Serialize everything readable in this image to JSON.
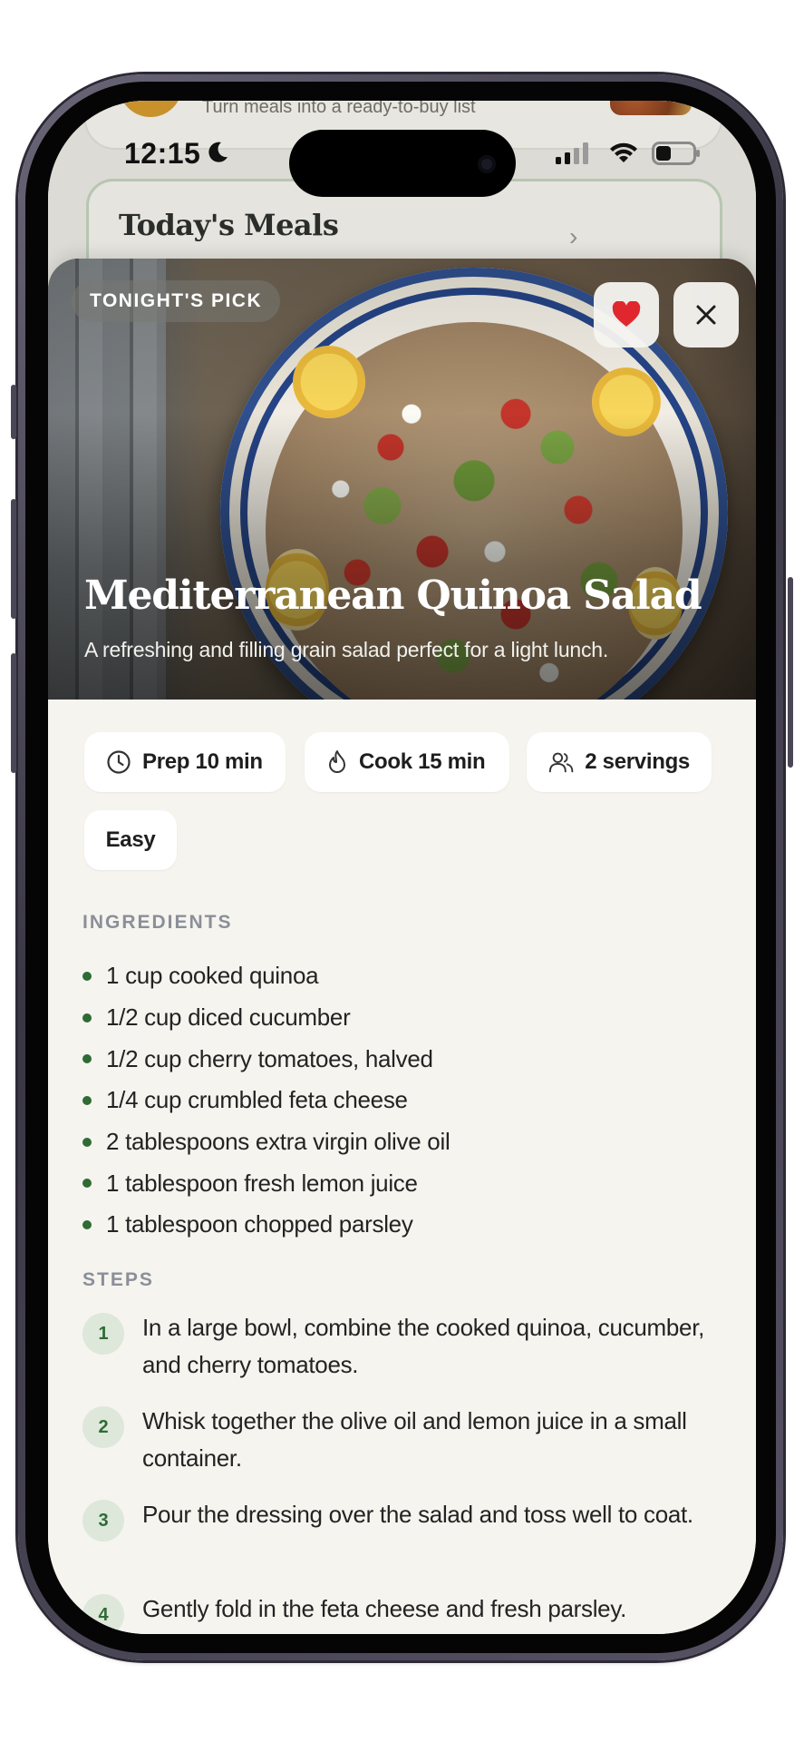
{
  "status_bar": {
    "time": "12:15"
  },
  "background": {
    "tagline": "Turn meals into a ready-to-buy list",
    "meals_title": "Today's Meals"
  },
  "recipe": {
    "badge": "TONIGHT'S PICK",
    "title": "Mediterranean Quinoa Salad",
    "description": "A refreshing and filling grain salad perfect for a light lunch.",
    "chips": {
      "prep": "Prep 10 min",
      "cook": "Cook 15 min",
      "servings": "2 servings",
      "difficulty": "Easy"
    },
    "ingredients_label": "INGREDIENTS",
    "ingredients": [
      "1 cup cooked quinoa",
      "1/2 cup diced cucumber",
      "1/2 cup cherry tomatoes, halved",
      "1/4 cup crumbled feta cheese",
      "2 tablespoons extra virgin olive oil",
      "1 tablespoon fresh lemon juice",
      "1 tablespoon chopped parsley"
    ],
    "steps_label": "STEPS",
    "steps": [
      {
        "num": "1",
        "text": "In a large bowl, combine the cooked quinoa, cucumber, and cherry tomatoes."
      },
      {
        "num": "2",
        "text": "Whisk together the olive oil and lemon juice in a small container."
      },
      {
        "num": "3",
        "text": "Pour the dressing over the salad and toss well to coat."
      },
      {
        "num": "4",
        "text": "Gently fold in the feta cheese and fresh parsley."
      }
    ]
  },
  "colors": {
    "accent_green": "#2e6b35",
    "heart_red": "#e0272e",
    "sheet_bg": "#f6f4ef"
  },
  "icons": [
    "moon-icon",
    "signal-icon",
    "wifi-icon",
    "battery-icon",
    "heart-icon",
    "close-icon",
    "clock-icon",
    "flame-icon",
    "people-icon"
  ]
}
